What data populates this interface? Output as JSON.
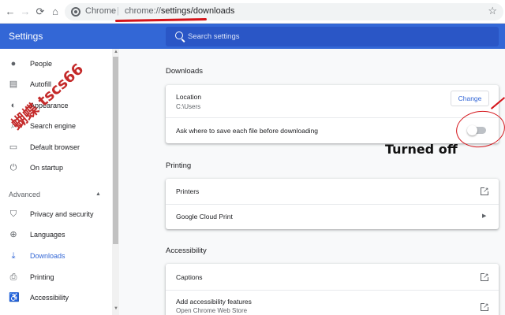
{
  "browser": {
    "back_glyph": "←",
    "forward_glyph": "→",
    "reload_glyph": "⟳",
    "home_glyph": "⌂",
    "site_label": "Chrome",
    "separator": "|",
    "url_scheme": "chrome://",
    "url_path": "settings/downloads",
    "bookmark_glyph": "☆"
  },
  "header": {
    "title": "Settings",
    "search_placeholder": "Search settings"
  },
  "sidebar": {
    "items": [
      {
        "label": "People",
        "icon": "person-icon",
        "glyph": "●"
      },
      {
        "label": "Autofill",
        "icon": "clipboard-icon",
        "glyph": "▤"
      },
      {
        "label": "Appearance",
        "icon": "palette-icon",
        "glyph": "◐"
      },
      {
        "label": "Search engine",
        "icon": "search-icon",
        "glyph": "⌕"
      },
      {
        "label": "Default browser",
        "icon": "browser-icon",
        "glyph": "▭"
      },
      {
        "label": "On startup",
        "icon": "power-icon",
        "glyph": "⏻"
      }
    ],
    "advanced_label": "Advanced",
    "advanced_caret": "▲",
    "advanced_items": [
      {
        "label": "Privacy and security",
        "icon": "shield-icon",
        "glyph": "⛉"
      },
      {
        "label": "Languages",
        "icon": "globe-icon",
        "glyph": "⊕"
      },
      {
        "label": "Downloads",
        "icon": "download-icon",
        "glyph": "⤓",
        "active": true
      },
      {
        "label": "Printing",
        "icon": "printer-icon",
        "glyph": "⎙"
      },
      {
        "label": "Accessibility",
        "icon": "accessibility-icon",
        "glyph": "♿"
      }
    ],
    "active_color": "#3367d6"
  },
  "downloads": {
    "title": "Downloads",
    "location_label": "Location",
    "location_value": "C:\\Users",
    "change_label": "Change",
    "ask_label": "Ask where to save each file before downloading",
    "ask_enabled": false
  },
  "printing": {
    "title": "Printing",
    "printers_label": "Printers",
    "cloud_print_label": "Google Cloud Print"
  },
  "accessibility": {
    "title": "Accessibility",
    "captions_label": "Captions",
    "add_features_label": "Add accessibility features",
    "add_features_sub": "Open Chrome Web Store"
  },
  "annotations": {
    "turned_off": "Turned off",
    "watermark": "蝴蝶 tscs66",
    "mark_color": "#d4141a"
  },
  "colors": {
    "header_bg": "#3367d6",
    "search_bg": "#2a56c6",
    "page_bg": "#f8f9fa"
  }
}
